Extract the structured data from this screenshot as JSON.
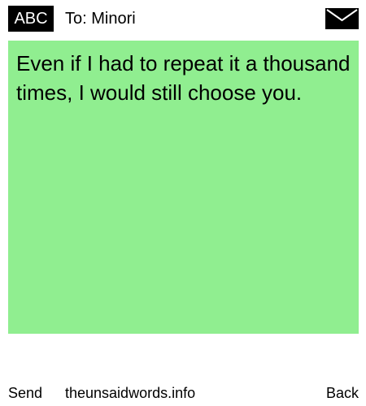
{
  "header": {
    "input_mode": "ABC",
    "recipient": "To: Minori",
    "status_icon": "envelope-icon"
  },
  "message": {
    "text": "Even if I had to repeat it a thousand times, I would still choose you.",
    "background_color": "#90ee90"
  },
  "softkeys": {
    "left_label": "Send",
    "center_label": "theunsaidwords.info",
    "right_label": "Back"
  }
}
